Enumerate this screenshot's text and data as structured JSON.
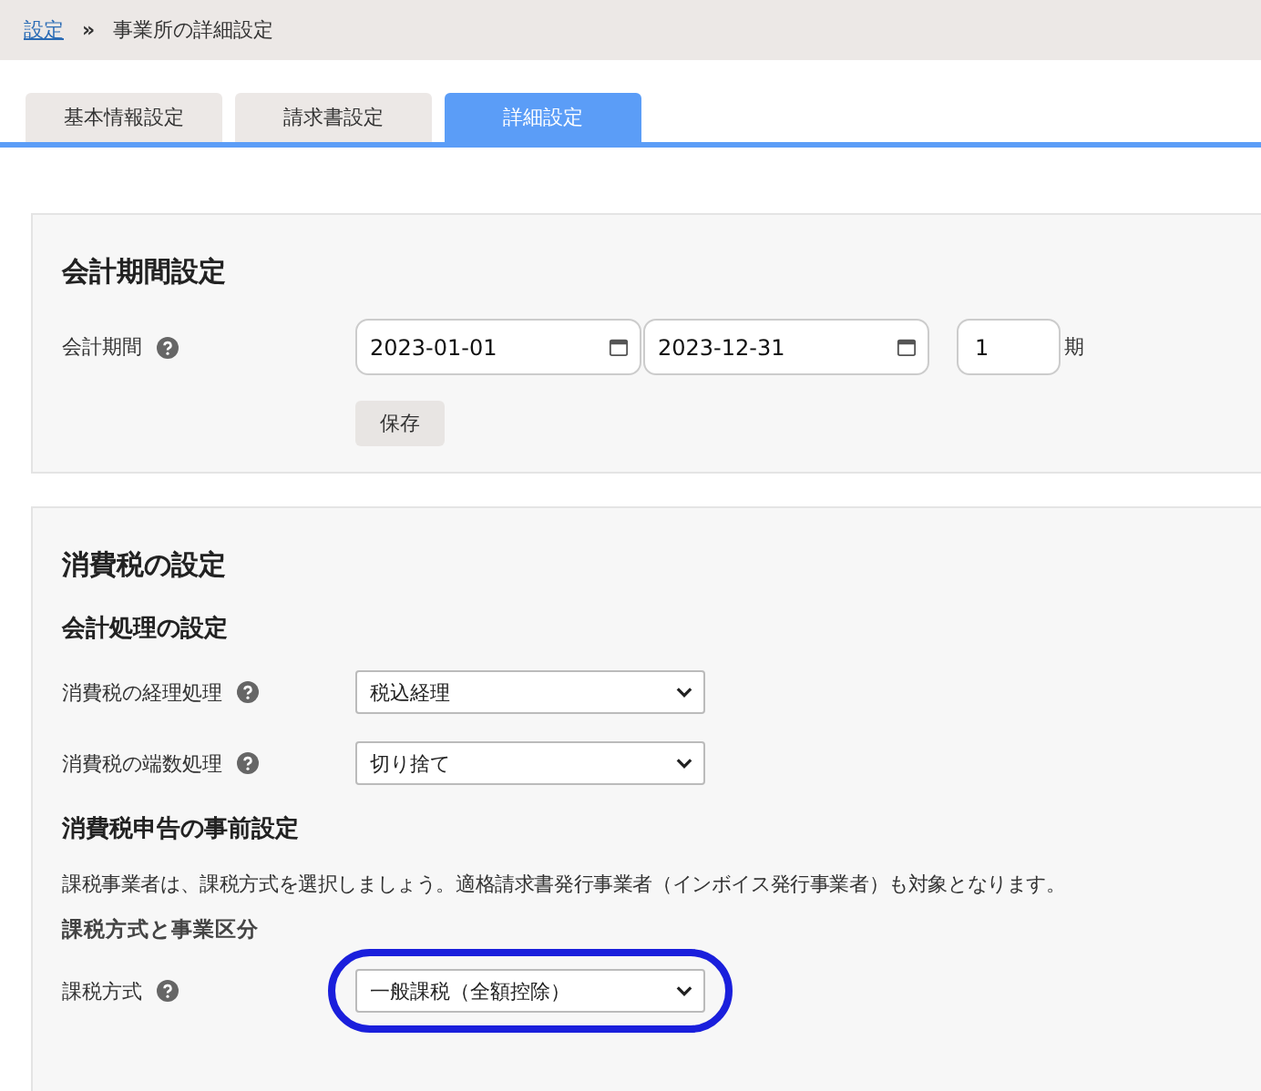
{
  "breadcrumb": {
    "link": "設定",
    "separator": "»",
    "current": "事業所の詳細設定"
  },
  "tabs": [
    {
      "label": "基本情報設定",
      "selected": false
    },
    {
      "label": "請求書設定",
      "selected": false
    },
    {
      "label": "詳細設定",
      "selected": true
    }
  ],
  "period_section": {
    "title": "会計期間設定",
    "label": "会計期間",
    "start": "2023-01-01",
    "end": "2023-12-31",
    "term": "1",
    "term_unit": "期",
    "save": "保存"
  },
  "tax_section": {
    "title": "消費税の設定",
    "blocks": [
      {
        "kind": "heading",
        "text": "会計処理の設定"
      },
      {
        "kind": "select",
        "label": "消費税の経理処理",
        "value": "税込経理",
        "highlighted": false
      },
      {
        "kind": "select",
        "label": "消費税の端数処理",
        "value": "切り捨て",
        "highlighted": false
      },
      {
        "kind": "heading",
        "text": "消費税申告の事前設定"
      },
      {
        "kind": "note",
        "text": "課税事業者は、課税方式を選択しましょう。適格請求書発行事業者（インボイス発行事業者）も対象となります。"
      },
      {
        "kind": "subheading",
        "text": "課税方式と事業区分"
      },
      {
        "kind": "select",
        "label": "課税方式",
        "value": "一般課税（全額控除）",
        "highlighted": true
      }
    ]
  }
}
